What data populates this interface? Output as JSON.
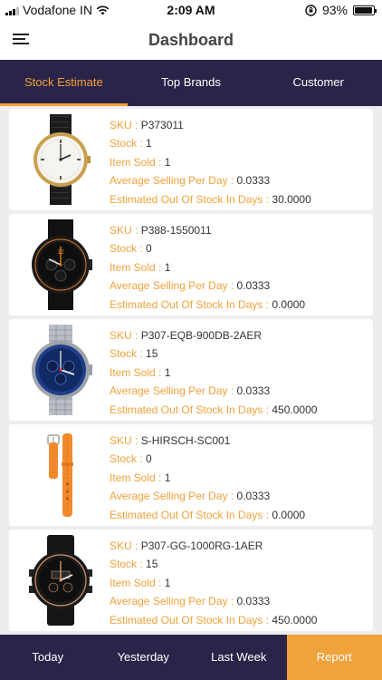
{
  "status_bar": {
    "carrier": "Vodafone IN",
    "time": "2:09 AM",
    "battery": "93%",
    "battery_level": 0.93
  },
  "header": {
    "title": "Dashboard"
  },
  "tabs": [
    {
      "label": "Stock Estimate"
    },
    {
      "label": "Top Brands"
    },
    {
      "label": "Customer"
    }
  ],
  "labels": {
    "sku": "SKU : ",
    "stock": "Stock : ",
    "item_sold": "Item Sold : ",
    "avg_selling": "Average Selling Per Day : ",
    "est_out": "Estimated Out Of Stock In Days : "
  },
  "items": [
    {
      "sku": "P373011",
      "stock": "1",
      "item_sold": "1",
      "avg_selling": "0.0333",
      "est_out": "30.0000",
      "image": "gold-dress-watch"
    },
    {
      "sku": "P388-1550011",
      "stock": "0",
      "item_sold": "1",
      "avg_selling": "0.0333",
      "est_out": "0.0000",
      "image": "black-chronograph-watch"
    },
    {
      "sku": "P307-EQB-900DB-2AER",
      "stock": "15",
      "item_sold": "1",
      "avg_selling": "0.0333",
      "est_out": "450.0000",
      "image": "steel-blue-chronograph-watch"
    },
    {
      "sku": "S-HIRSCH-SC001",
      "stock": "0",
      "item_sold": "1",
      "avg_selling": "0.0333",
      "est_out": "0.0000",
      "image": "orange-watch-strap"
    },
    {
      "sku": "P307-GG-1000RG-1AER",
      "stock": "15",
      "item_sold": "1",
      "avg_selling": "0.0333",
      "est_out": "450.0000",
      "image": "black-rose-gold-sport-watch"
    }
  ],
  "bottom_nav": [
    {
      "label": "Today"
    },
    {
      "label": "Yesterday"
    },
    {
      "label": "Last Week"
    },
    {
      "label": "Report"
    }
  ],
  "colors": {
    "accent": "#f0a23b",
    "nav_bg": "#2b2449",
    "background": "#ededed"
  }
}
